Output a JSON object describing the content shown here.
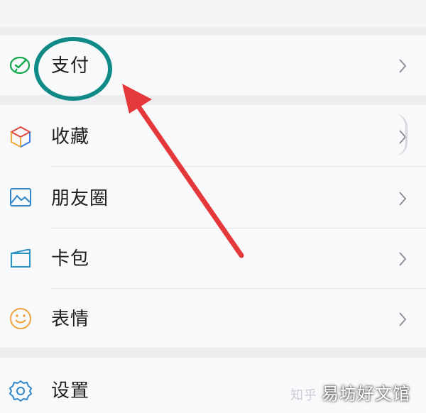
{
  "menu": {
    "items": [
      {
        "label": "支付",
        "icon": "wechat-pay-icon"
      },
      {
        "label": "收藏",
        "icon": "favorites-cube-icon"
      },
      {
        "label": "朋友圈",
        "icon": "moments-photo-icon"
      },
      {
        "label": "卡包",
        "icon": "card-wallet-icon"
      },
      {
        "label": "表情",
        "icon": "emoji-smile-icon"
      },
      {
        "label": "设置",
        "icon": "settings-gear-icon"
      }
    ]
  },
  "annotation": {
    "circle_color": "#0f8a86",
    "arrow_color": "#e5383b"
  },
  "watermark": {
    "faint_text": "知乎",
    "text": "易坊好文馆"
  }
}
